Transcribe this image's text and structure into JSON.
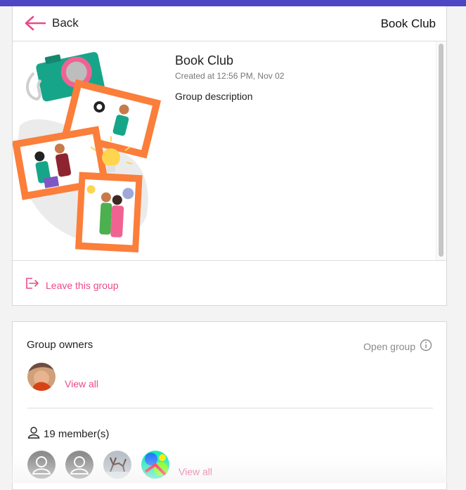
{
  "header": {
    "back_label": "Back",
    "title": "Book Club"
  },
  "group": {
    "name": "Book Club",
    "created": "Created at 12:56 PM, Nov 02",
    "description": "Group description"
  },
  "actions": {
    "leave_label": "Leave this group"
  },
  "owners": {
    "title": "Group owners",
    "privacy_label": "Open group",
    "view_all": "View all"
  },
  "members": {
    "count_label": "19 member(s)",
    "view_all": "View all"
  },
  "colors": {
    "accent": "#e94b8a",
    "brand_bar": "#4d47c3",
    "frame": "#fb7e3b"
  }
}
